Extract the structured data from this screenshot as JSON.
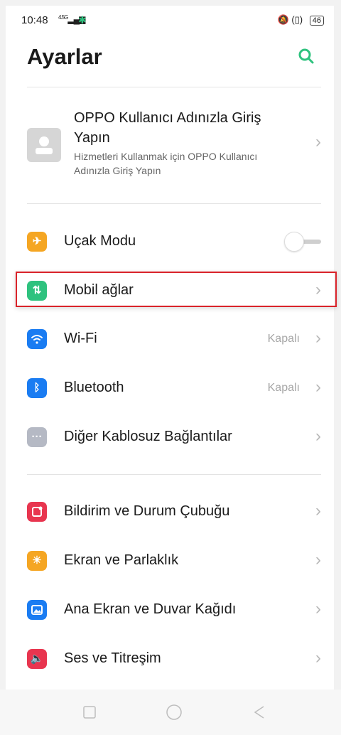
{
  "status_bar": {
    "time": "10:48",
    "network": "4.5G",
    "battery": "46"
  },
  "header": {
    "title": "Ayarlar",
    "search_icon": "search-icon"
  },
  "account": {
    "title": "OPPO Kullanıcı Adınızla Giriş Yapın",
    "subtitle": "Hizmetleri Kullanmak için OPPO Kullanıcı Adınızla Giriş Yapın"
  },
  "settings": [
    {
      "label": "Uçak Modu",
      "icon": "airplane-icon",
      "color": "#f5a623",
      "toggle": false
    },
    {
      "label": "Mobil ağlar",
      "icon": "mobile-data-icon",
      "color": "#2ec27e"
    },
    {
      "label": "Wi-Fi",
      "icon": "wifi-icon",
      "color": "#1a7cf2",
      "value": "Kapalı"
    },
    {
      "label": "Bluetooth",
      "icon": "bluetooth-icon",
      "color": "#1a7cf2",
      "value": "Kapalı"
    },
    {
      "label": "Diğer Kablosuz Bağlantılar",
      "icon": "more-icon",
      "color": "#b5b9c4"
    },
    {
      "label": "Bildirim ve Durum Çubuğu",
      "icon": "notification-icon",
      "color": "#e8354f"
    },
    {
      "label": "Ekran ve Parlaklık",
      "icon": "brightness-icon",
      "color": "#f5a623"
    },
    {
      "label": "Ana Ekran ve Duvar Kağıdı",
      "icon": "wallpaper-icon",
      "color": "#1a7cf2"
    },
    {
      "label": "Ses ve Titreşim",
      "icon": "sound-icon",
      "color": "#e8354f"
    }
  ],
  "colors": {
    "accent": "#2ec27e",
    "highlight": "#d9232a"
  }
}
